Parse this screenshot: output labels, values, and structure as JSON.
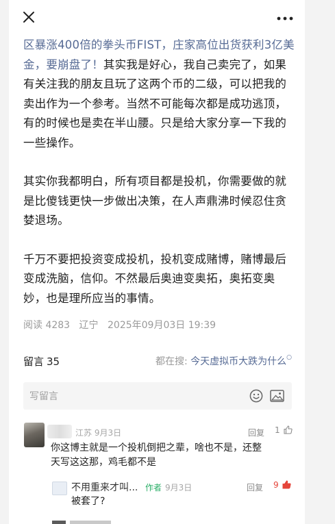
{
  "icons": {
    "close": "close-icon",
    "more": "more-icon",
    "emoji": "emoji-icon",
    "image": "image-icon",
    "thumb": "thumb-up-icon",
    "search_hint": "search-icon"
  },
  "colors": {
    "link": "#576b95",
    "author_tag": "#2aae67",
    "like_active": "#e5453a"
  },
  "article": {
    "p1_link": "区暴涨400倍的拳头币FIST，庄家高位出货获利3亿美金，要崩盘了！",
    "p1_text": "其实我是好心，我自己卖完了，如果有关注我的朋友且玩了这两个币的二级，可以把我的卖出作为一个参考。当然不可能每次都是成功逃顶，有的时候也是卖在半山腰。只是给大家分享一下我的一些操作。",
    "p2": "其实你我都明白，所有项目都是投机，你需要做的就是比傻钱更快一步做出决策，在人声鼎沸时候忍住贪婪退场。",
    "p3": "千万不要把投资变成投机，投机变成赌博，赌博最后变成洗脑，信仰。不然最后奥迪变奥拓，奥拓变奥妙，也是理所应当的事情。"
  },
  "meta": {
    "reads": "阅读 4283",
    "location": "辽宁",
    "datetime": "2025年09月03日 19:39"
  },
  "comments": {
    "title": "留言",
    "count": "35",
    "trending_prefix": "都在搜:",
    "trending_link": "今天虚拟币大跌为什么",
    "input_placeholder": "写留言",
    "items": [
      {
        "meta": "江苏 9月3日",
        "reply_label": "回复",
        "likes": "1",
        "text_line1": "你这博主就是一个投机倒把之辈，啥也不是，还整",
        "text_line2": "天写这这那，鸡毛都不是",
        "reply": {
          "name": "不用重来才叫...",
          "author_tag": "作者",
          "date": "9月3日",
          "reply_label": "回复",
          "likes": "9",
          "text": "被套了?"
        }
      }
    ]
  }
}
